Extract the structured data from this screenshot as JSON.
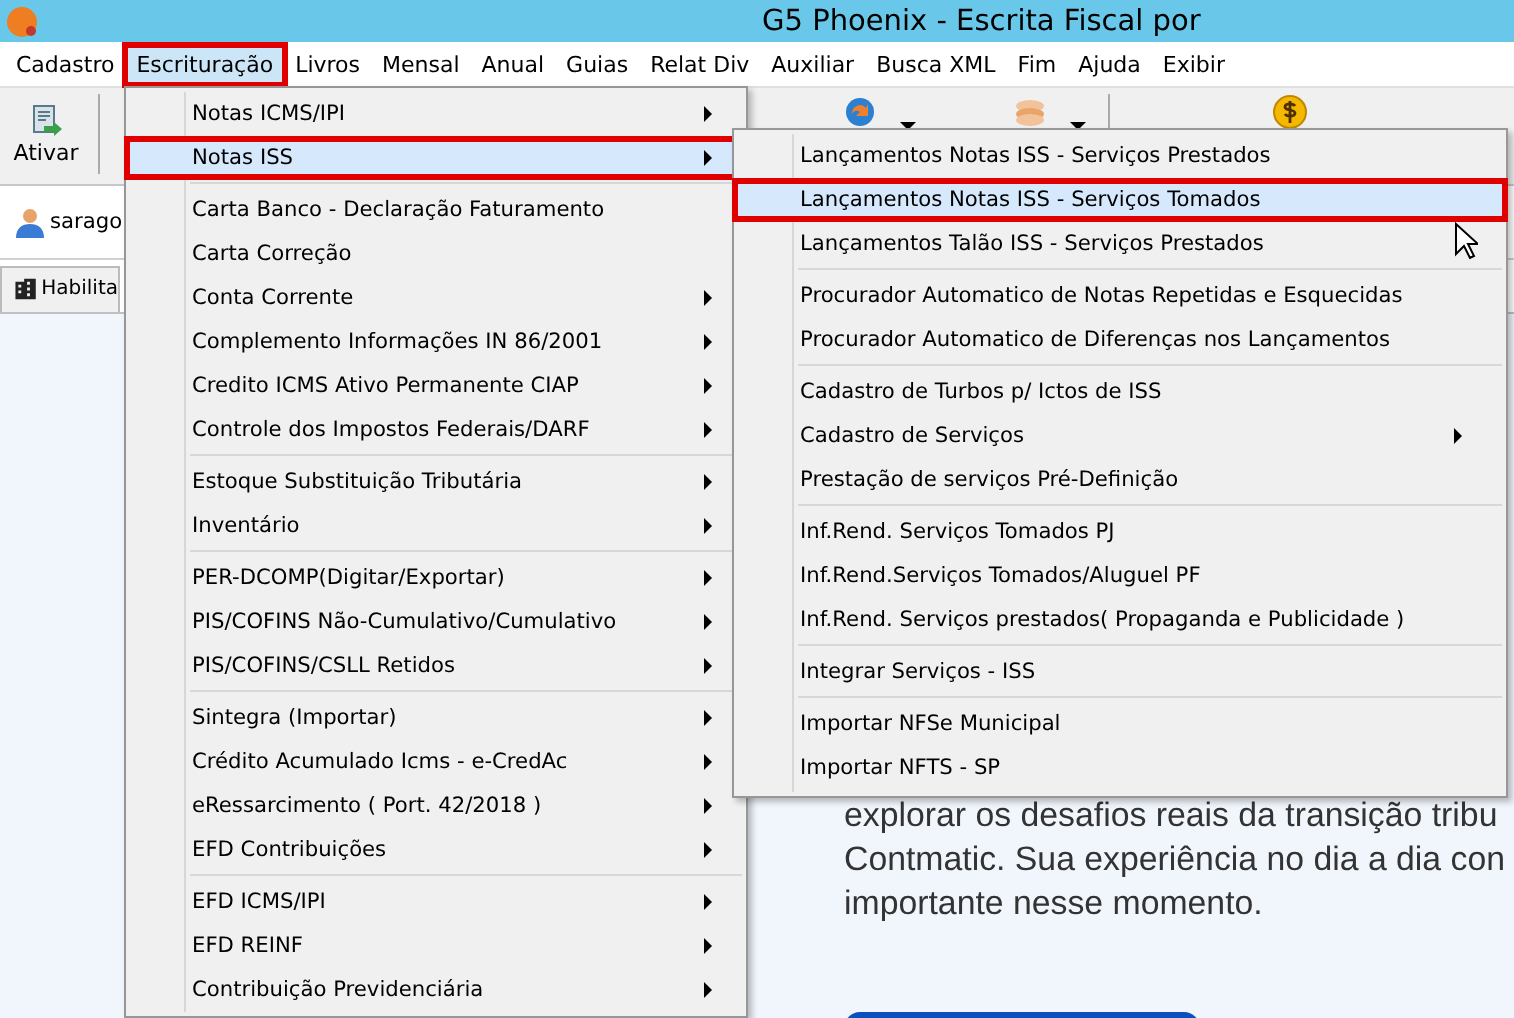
{
  "window": {
    "title": "G5 Phoenix - Escrita Fiscal por"
  },
  "menubar": [
    {
      "label": "Cadastro",
      "selected": false
    },
    {
      "label": "Escrituração",
      "selected": true
    },
    {
      "label": "Livros",
      "selected": false
    },
    {
      "label": "Mensal",
      "selected": false
    },
    {
      "label": "Anual",
      "selected": false
    },
    {
      "label": "Guias",
      "selected": false
    },
    {
      "label": "Relat Div",
      "selected": false
    },
    {
      "label": "Auxiliar",
      "selected": false
    },
    {
      "label": "Busca XML",
      "selected": false
    },
    {
      "label": "Fim",
      "selected": false
    },
    {
      "label": "Ajuda",
      "selected": false
    },
    {
      "label": "Exibir",
      "selected": false
    }
  ],
  "toolbar": {
    "buttons": [
      {
        "kind": "activate",
        "label": "Ativar"
      },
      {
        "kind": "refresh",
        "dropdown": true
      },
      {
        "kind": "coins",
        "dropdown": true
      },
      {
        "kind": "dollar",
        "dropdown": false
      }
    ]
  },
  "user": {
    "name": "sarago"
  },
  "tab": {
    "label": "Habilita"
  },
  "menu": {
    "groups": [
      [
        {
          "label": "Notas ICMS/IPI",
          "submenu": true,
          "selected": false
        },
        {
          "label": "Notas ISS",
          "submenu": true,
          "selected": true
        }
      ],
      [
        {
          "label": "Carta Banco - Declaração Faturamento",
          "submenu": false,
          "selected": false
        },
        {
          "label": "Carta Correção",
          "submenu": false,
          "selected": false
        },
        {
          "label": "Conta Corrente",
          "submenu": true,
          "selected": false
        },
        {
          "label": "Complemento Informações IN 86/2001",
          "submenu": true,
          "selected": false
        },
        {
          "label": "Credito ICMS Ativo Permanente CIAP",
          "submenu": true,
          "selected": false
        },
        {
          "label": "Controle dos Impostos Federais/DARF",
          "submenu": true,
          "selected": false
        }
      ],
      [
        {
          "label": "Estoque Substituição Tributária",
          "submenu": true,
          "selected": false
        },
        {
          "label": "Inventário",
          "submenu": true,
          "selected": false
        }
      ],
      [
        {
          "label": "PER-DCOMP(Digitar/Exportar)",
          "submenu": true,
          "selected": false
        },
        {
          "label": "PIS/COFINS Não-Cumulativo/Cumulativo",
          "submenu": true,
          "selected": false
        },
        {
          "label": "PIS/COFINS/CSLL Retidos",
          "submenu": true,
          "selected": false
        }
      ],
      [
        {
          "label": "Sintegra (Importar)",
          "submenu": true,
          "selected": false
        },
        {
          "label": "Crédito Acumulado Icms - e-CredAc",
          "submenu": true,
          "selected": false
        },
        {
          "label": "eRessarcimento ( Port. 42/2018 )",
          "submenu": true,
          "selected": false
        },
        {
          "label": "EFD Contribuições",
          "submenu": true,
          "selected": false
        }
      ],
      [
        {
          "label": "EFD ICMS/IPI",
          "submenu": true,
          "selected": false
        },
        {
          "label": "EFD REINF",
          "submenu": true,
          "selected": false
        },
        {
          "label": "Contribuição Previdenciária",
          "submenu": true,
          "selected": false
        }
      ]
    ]
  },
  "submenu": {
    "groups": [
      [
        {
          "label": "Lançamentos Notas ISS - Serviços Prestados",
          "submenu": false,
          "selected": false
        },
        {
          "label": "Lançamentos Notas ISS - Serviços Tomados",
          "submenu": false,
          "selected": true
        },
        {
          "label": "Lançamentos Talão ISS - Serviços Prestados",
          "submenu": false,
          "selected": false
        }
      ],
      [
        {
          "label": "Procurador Automatico de Notas Repetidas e Esquecidas",
          "submenu": false,
          "selected": false
        },
        {
          "label": "Procurador Automatico de Diferenças nos Lançamentos",
          "submenu": false,
          "selected": false
        }
      ],
      [
        {
          "label": "Cadastro de Turbos p/ Ictos de ISS",
          "submenu": false,
          "selected": false
        },
        {
          "label": "Cadastro de Serviços",
          "submenu": true,
          "selected": false
        },
        {
          "label": "Prestação de serviços Pré-Definição",
          "submenu": false,
          "selected": false
        }
      ],
      [
        {
          "label": "Inf.Rend. Serviços Tomados PJ",
          "submenu": false,
          "selected": false
        },
        {
          "label": "Inf.Rend.Serviços Tomados/Aluguel PF",
          "submenu": false,
          "selected": false
        },
        {
          "label": "Inf.Rend. Serviços prestados( Propaganda e Publicidade )",
          "submenu": false,
          "selected": false
        }
      ],
      [
        {
          "label": "Integrar Serviços - ISS",
          "submenu": false,
          "selected": false
        }
      ],
      [
        {
          "label": "Importar NFSe Municipal",
          "submenu": false,
          "selected": false
        },
        {
          "label": "Importar NFTS - SP",
          "submenu": false,
          "selected": false
        }
      ]
    ]
  },
  "content": {
    "lines": [
      "explorar os desafios reais da transição tribu",
      "Contmatic. Sua experiência no dia a dia con",
      "importante nesse momento."
    ]
  }
}
